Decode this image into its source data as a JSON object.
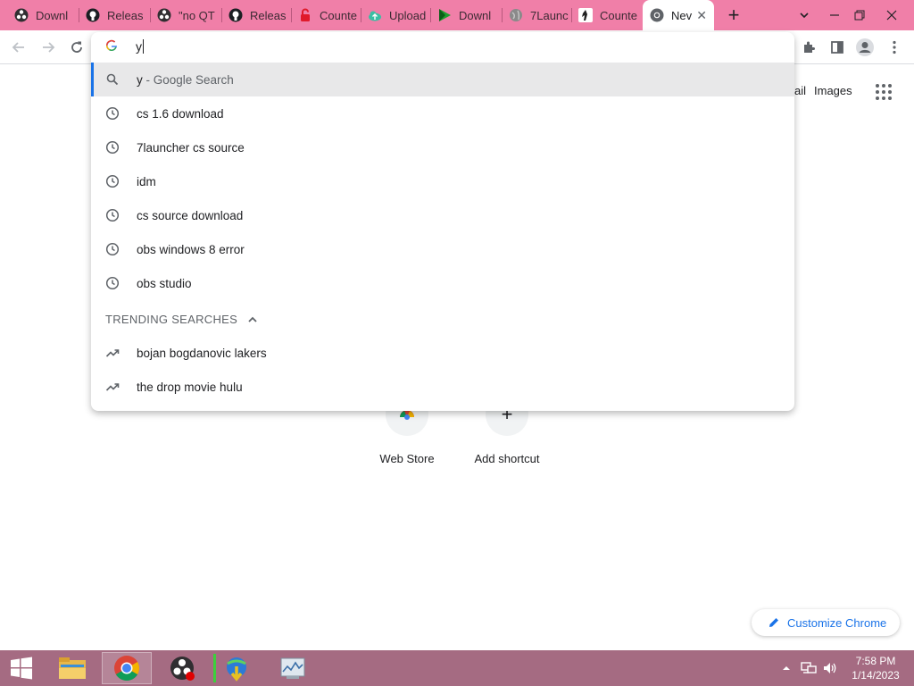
{
  "tabs": [
    {
      "title": "Downl",
      "icon": "obs-icon"
    },
    {
      "title": "Releas",
      "icon": "github-icon"
    },
    {
      "title": "\"no QT",
      "icon": "obs-icon"
    },
    {
      "title": "Releas",
      "icon": "github-icon"
    },
    {
      "title": "Counte",
      "icon": "unlock-icon"
    },
    {
      "title": "Upload",
      "icon": "cloud-upload-icon"
    },
    {
      "title": "Downl",
      "icon": "play-arrow-icon"
    },
    {
      "title": "7Launc",
      "icon": "globe-icon"
    },
    {
      "title": "Counte",
      "icon": "cs-icon"
    },
    {
      "title": "Nev",
      "icon": "chrome-icon"
    }
  ],
  "omnibox": {
    "typed_text": "y",
    "suggestions": [
      {
        "text": "y",
        "suffix": " - Google Search",
        "icon": "search-icon"
      },
      {
        "text": "cs 1.6 download",
        "suffix": "",
        "icon": "history-icon"
      },
      {
        "text": "7launcher cs source",
        "suffix": "",
        "icon": "history-icon"
      },
      {
        "text": "idm",
        "suffix": "",
        "icon": "history-icon"
      },
      {
        "text": "cs source download",
        "suffix": "",
        "icon": "history-icon"
      },
      {
        "text": "obs windows 8 error",
        "suffix": "",
        "icon": "history-icon"
      },
      {
        "text": "obs studio",
        "suffix": "",
        "icon": "history-icon"
      }
    ],
    "trending_header": "TRENDING SEARCHES",
    "trending": [
      {
        "text": "bojan bogdanovic lakers",
        "icon": "trending-up-icon"
      },
      {
        "text": "the drop movie hulu",
        "icon": "trending-up-icon"
      }
    ]
  },
  "page": {
    "gmail_partial": "ail",
    "images_label": "Images",
    "shortcuts": [
      {
        "label": "Web Store"
      },
      {
        "label": "Add shortcut"
      }
    ],
    "customize_label": "Customize Chrome"
  },
  "taskbar": {
    "time": "7:58 PM",
    "date": "1/14/2023"
  },
  "colors": {
    "tabstrip": "#f07fa8",
    "taskbar": "#a56b82",
    "accent": "#1a73e8"
  }
}
